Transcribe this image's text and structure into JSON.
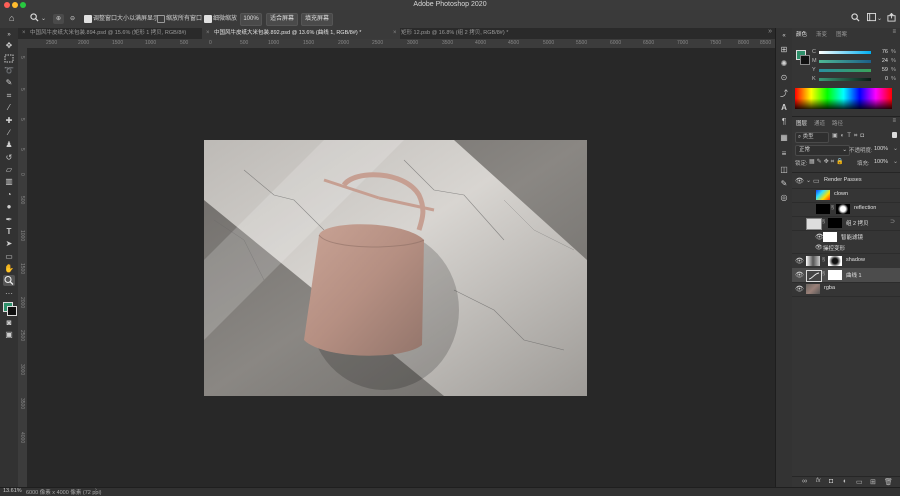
{
  "app": {
    "title": "Adobe Photoshop 2020"
  },
  "options_bar": {
    "resize_windows_label": "调整窗口大小以满屏显示",
    "zoom_all_label": "缩放所有窗口",
    "scrubby_zoom_label": "细微缩放",
    "zoom_value": "100%",
    "fit_screen_label": "适合屏幕",
    "fill_screen_label": "填充屏幕",
    "resize_windows_checked": true,
    "zoom_all_checked": false,
    "scrubby_zoom_checked": true
  },
  "doc_tabs": [
    {
      "label": "中国风牛皮纸大米包装.894.psd @ 15.6% (矩形 1 拷贝, RGB/8#)",
      "active": false
    },
    {
      "label": "中国风牛皮纸大米包装.892.psd @ 13.6% (曲线 1, RGB/8#) *",
      "active": true
    },
    {
      "label": "矩形 12.psb @ 16.8% (组 2 拷贝, RGB/8#) *",
      "active": false
    }
  ],
  "ruler_top": [
    "2500",
    "2000",
    "1500",
    "1000",
    "500",
    "0",
    "500",
    "1000",
    "1500",
    "2000",
    "2500",
    "3000",
    "3500",
    "4000",
    "4500",
    "5000",
    "5500",
    "6000",
    "6500",
    "7000",
    "7500",
    "8000",
    "8500"
  ],
  "ruler_left": [
    "5",
    "5",
    "5",
    "5",
    "0",
    "500",
    "1000",
    "1500",
    "2000",
    "2500",
    "3000",
    "3500",
    "4000"
  ],
  "status": {
    "zoom": "13.61%",
    "doc_info": "6000 像素 x 4000 像素 (72 ppi)"
  },
  "color_panel": {
    "tabs": [
      "颜色",
      "渐变",
      "图案"
    ],
    "channels": [
      {
        "label": "C",
        "value": "76"
      },
      {
        "label": "M",
        "value": "24"
      },
      {
        "label": "Y",
        "value": "59"
      },
      {
        "label": "K",
        "value": "0"
      }
    ],
    "pct": "%",
    "foreground": "#2e8f6a"
  },
  "layers_panel": {
    "tabs": [
      "图层",
      "通道",
      "路径"
    ],
    "filter_label": "类型",
    "blend_mode": "正常",
    "opacity_label": "不透明度:",
    "opacity_value": "100%",
    "lock_label": "锁定:",
    "fill_label": "填充:",
    "fill_value": "100%",
    "layers": [
      {
        "name": "Render Passes",
        "kind": "group"
      },
      {
        "name": "clown",
        "kind": "layer"
      },
      {
        "name": "reflection",
        "kind": "layer"
      },
      {
        "name": "组 2 拷贝",
        "kind": "smart"
      },
      {
        "name": "智能滤镜",
        "kind": "filter"
      },
      {
        "name": "操控变形",
        "kind": "filter-item"
      },
      {
        "name": "shadow",
        "kind": "layer"
      },
      {
        "name": "曲线 1",
        "kind": "adjust",
        "selected": true
      },
      {
        "name": "rgba",
        "kind": "layer"
      }
    ]
  }
}
